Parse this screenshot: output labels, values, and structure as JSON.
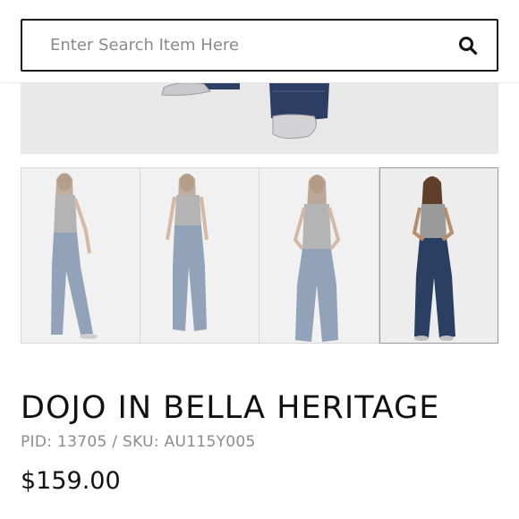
{
  "search": {
    "placeholder": "Enter Search Item Here",
    "icon": "search-icon"
  },
  "gallery": {
    "thumbnail_count": 4,
    "active_index": 3
  },
  "product": {
    "title": "DOJO IN BELLA HERITAGE",
    "pid_sku": "PID: 13705 / SKU: AU115Y005",
    "price": "$159.00"
  },
  "colors": {
    "text": "#111111",
    "meta": "#8c8c8c",
    "denim_light": "#5f7896",
    "denim_dark": "#2b3f63",
    "tank_top": "#9a9a9a"
  }
}
